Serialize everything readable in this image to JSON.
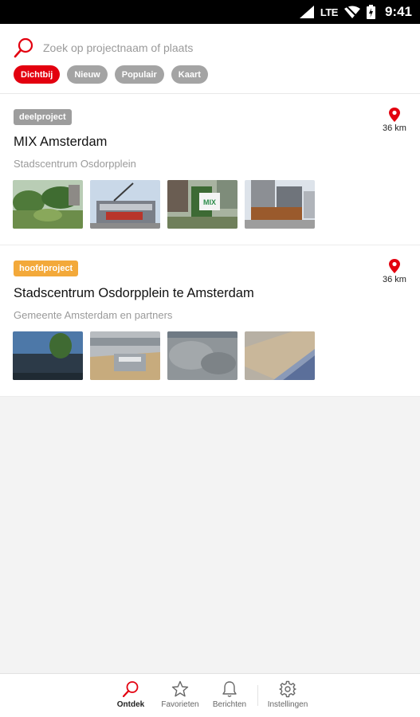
{
  "status_bar": {
    "network": "LTE",
    "time": "9:41"
  },
  "search": {
    "placeholder": "Zoek op projectnaam of plaats"
  },
  "filters": [
    {
      "label": "Dichtbij",
      "active": true
    },
    {
      "label": "Nieuw",
      "active": false
    },
    {
      "label": "Populair",
      "active": false
    },
    {
      "label": "Kaart",
      "active": false
    }
  ],
  "projects": [
    {
      "badge": "deelproject",
      "title": "MIX Amsterdam",
      "subtitle": "Stadscentrum Osdorpplein",
      "distance": "36 km",
      "sign_text": "MIX"
    },
    {
      "badge": "hoofdproject",
      "title": "Stadscentrum Osdorpplein te Amsterdam",
      "subtitle": "Gemeente Amsterdam en partners",
      "distance": "36 km"
    }
  ],
  "bottom_nav": [
    {
      "label": "Ontdek",
      "icon": "search-icon",
      "active": true
    },
    {
      "label": "Favorieten",
      "icon": "star-icon",
      "active": false
    },
    {
      "label": "Berichten",
      "icon": "bell-icon",
      "active": false
    },
    {
      "label": "Instellingen",
      "icon": "gear-icon",
      "active": false
    }
  ],
  "colors": {
    "accent": "#e3000f",
    "deelproject_badge": "#9d9d9d",
    "hoofdproject_badge": "#f3a93a"
  }
}
